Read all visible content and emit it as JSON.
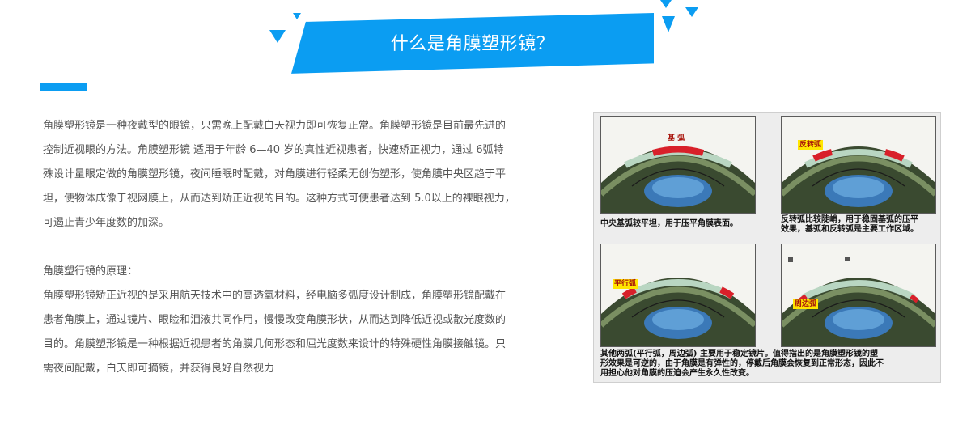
{
  "header": {
    "title": "什么是角膜塑形镜？"
  },
  "intro": {
    "lines": [
      "角膜塑形镜是一种夜戴型的眼镜，只需晚上配戴白天视力即可恢复正常。角膜塑形镜是目前最先进的",
      "控制近视眼的方法。角膜塑形镜 适用于年龄 6—40 岁的真性近视患者，快速矫正视力，通过 6弧特",
      "殊设计量眼定做的角膜塑形镜，夜间睡眠时配戴，对角膜进行轻柔无创伤塑形，使角膜中央区趋于平",
      "坦，使物体成像于视网膜上，从而达到矫正近视的目的。这种方式可使患者达到 5.0以上的裸眼视力，",
      "可遏止青少年度数的加深。"
    ]
  },
  "principle": {
    "heading": "角膜塑行镜的原理：",
    "lines": [
      "角膜塑形镜矫正近视的是采用航天技术中的高透氧材料，经电脑多弧度设计制成，角膜塑形镜配戴在",
      "患者角膜上，通过镜片、眼睑和泪液共同作用，慢慢改变角膜形状，从而达到降低近视或散光度数的",
      "目的。角膜塑形镜是一种根据近视患者的角膜几何形态和屈光度数来设计的特殊硬性角膜接触镜。只",
      "需夜间配戴，白天即可摘镜，并获得良好自然视力"
    ]
  },
  "figure": {
    "labels": {
      "base_arc": "基 弧",
      "reverse_arc": "反转弧",
      "parallel_arc": "平行弧",
      "edge_arc": "周边弧"
    },
    "captions": {
      "top_left": [
        "中央基弧较平坦，用于压平角膜表面。"
      ],
      "top_right": [
        "反转弧比较陡峭，用于稳固基弧的压平",
        "效果，基弧和反转弧是主要工作区域。"
      ],
      "bottom": [
        "其他两弧(平行弧，周边弧) 主要用于稳定镜片。值得指出的是角膜塑形镜的塑",
        "形效果是可逆的，由于角膜是有弹性的，停戴后角膜会恢复到正常形态，因此不",
        "用担心他对角膜的压迫会产生永久性改变。"
      ]
    }
  },
  "colors": {
    "accent": "#0b9df2",
    "text": "#555555",
    "highlight": "#d8202a",
    "label_bg": "#ffe600"
  }
}
